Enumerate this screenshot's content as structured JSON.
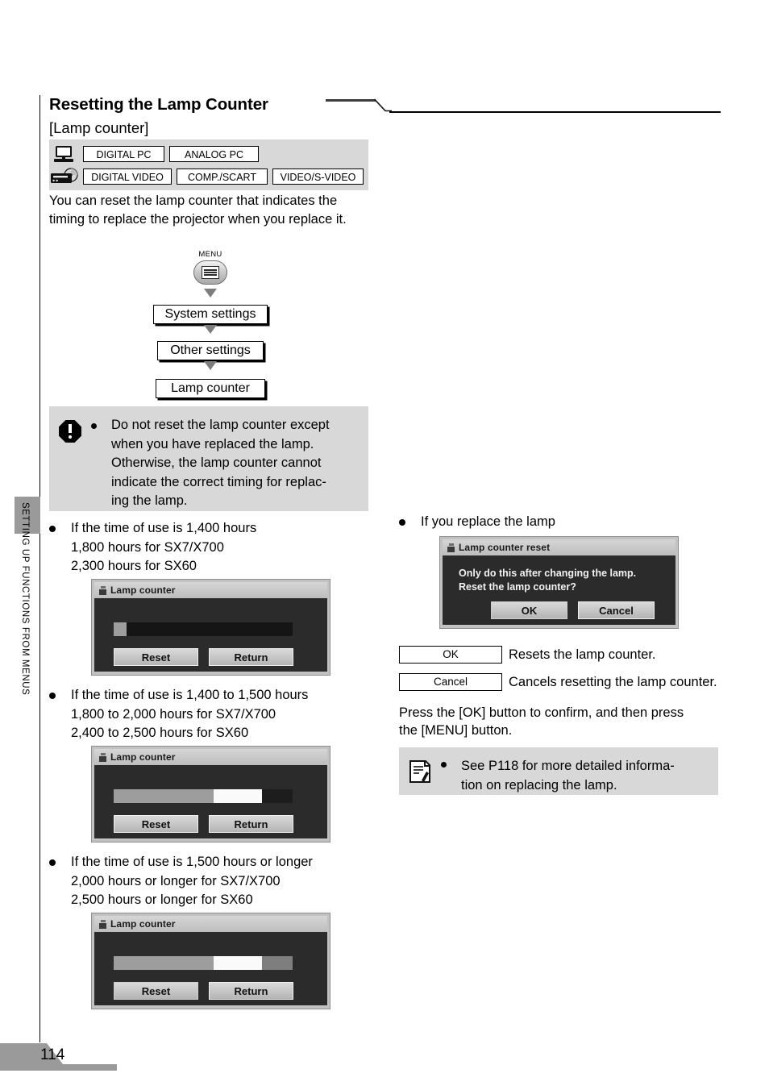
{
  "page": {
    "number": "114",
    "side_tab_label": "SETTING UP FUNCTIONS FROM MENUS"
  },
  "header": {
    "title": "Resetting the Lamp Counter",
    "subtitle": "[Lamp counter]"
  },
  "source_panel": {
    "row1_icon": "computer-monitor-icon",
    "row2_icon": "video-player-icon",
    "row1": [
      "DIGITAL PC",
      "ANALOG PC"
    ],
    "row2": [
      "DIGITAL VIDEO",
      "COMP./SCART",
      "VIDEO/S-VIDEO"
    ]
  },
  "intro": "You can reset the lamp counter that indicates the timing to replace the projector when you replace it.",
  "flow": {
    "menu_label": "MENU",
    "menu_icon": "menu-button-icon",
    "steps": [
      "System settings",
      "Other settings",
      "Lamp counter"
    ]
  },
  "caution": {
    "icon": "warning-octagon-icon",
    "lines": [
      "Do not reset the lamp counter except",
      "when you have replaced the lamp.",
      "Otherwise, the lamp counter cannot",
      "indicate the correct timing for replac-",
      "ing the lamp."
    ]
  },
  "cases": [
    {
      "lines": [
        "If the time of use is 1,400 hours",
        "1,800 hours for SX7/X700",
        "2,300 hours for SX60"
      ],
      "osd": {
        "title": "Lamp counter",
        "buttons": [
          "Reset",
          "Return"
        ],
        "bar": [
          {
            "color": "#9d9d9d",
            "pct": 7
          },
          {
            "color": "#151515",
            "pct": 93
          }
        ]
      }
    },
    {
      "lines": [
        "If the time of use is 1,400 to 1,500 hours",
        "1,800 to 2,000 hours for SX7/X700",
        "2,400 to 2,500 hours for SX60"
      ],
      "osd": {
        "title": "Lamp counter",
        "buttons": [
          "Reset",
          "Return"
        ],
        "bar": [
          {
            "color": "#9d9d9d",
            "pct": 56
          },
          {
            "color": "#fafafa",
            "pct": 27
          },
          {
            "color": "#1d1d1d",
            "pct": 17
          }
        ]
      }
    },
    {
      "lines": [
        "If the time of use is 1,500 hours or longer",
        "2,000 hours or longer for SX7/X700",
        "2,500 hours or longer for SX60"
      ],
      "osd": {
        "title": "Lamp counter",
        "buttons": [
          "Reset",
          "Return"
        ],
        "bar": [
          {
            "color": "#9d9d9d",
            "pct": 56
          },
          {
            "color": "#fafafa",
            "pct": 27
          },
          {
            "color": "#7e7e7e",
            "pct": 17
          }
        ]
      }
    }
  ],
  "replace": {
    "heading": "If you replace the lamp",
    "osd": {
      "title": "Lamp counter reset",
      "message_line1": "Only do this after changing the lamp.",
      "message_line2": "Reset the lamp counter?",
      "buttons": [
        "OK",
        "Cancel"
      ]
    },
    "legend": [
      {
        "key": "OK",
        "desc": "Resets the lamp counter."
      },
      {
        "key": "Cancel",
        "desc": "Cancels resetting the lamp counter."
      }
    ],
    "closing_line1": "Press the [OK] button to confirm, and then press",
    "closing_line2": "the [MENU] button."
  },
  "reference": {
    "icon": "document-reference-icon",
    "lines": [
      "See  P118  for  more  detailed  informa-",
      "tion on replacing the lamp."
    ]
  }
}
